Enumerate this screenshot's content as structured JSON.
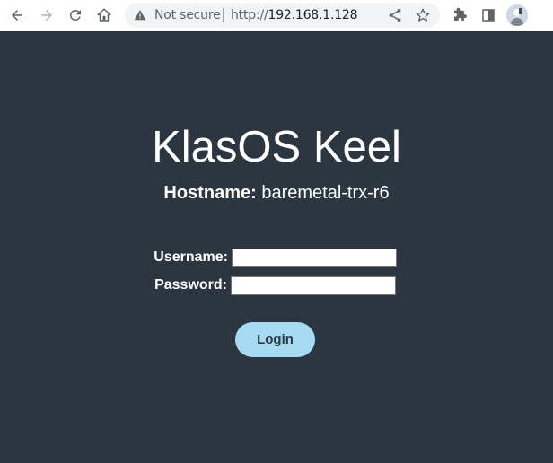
{
  "browser": {
    "security_label": "Not secure",
    "url_scheme": "http://",
    "url_host": "192.168.1.128"
  },
  "page": {
    "title": "KlasOS Keel",
    "hostname_label": "Hostname:",
    "hostname_value": "baremetal-trx-r6"
  },
  "form": {
    "username_label": "Username:",
    "username_value": "",
    "password_label": "Password:",
    "password_value": "",
    "login_label": "Login"
  },
  "colors": {
    "background": "#2b3640",
    "button": "#a7dbf3"
  }
}
